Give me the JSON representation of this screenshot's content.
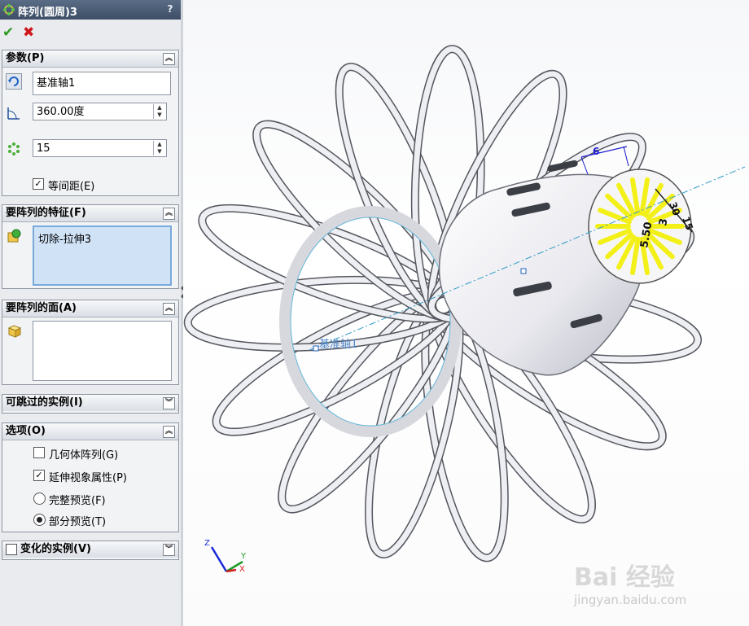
{
  "title": "阵列(圆周)3",
  "help_label": "?",
  "ok_label": "✔",
  "cancel_label": "✖",
  "params": {
    "header": "参数(P)",
    "axis_value": "基准轴1",
    "angle_value": "360.00度",
    "count_value": "15",
    "equal_spacing_label": "等间距(E)",
    "equal_spacing_checked": true
  },
  "features": {
    "header": "要阵列的特征(F)",
    "items": [
      "切除-拉伸3"
    ]
  },
  "faces": {
    "header": "要阵列的面(A)"
  },
  "skip": {
    "header": "可跳过的实例(I)"
  },
  "options": {
    "header": "选项(O)",
    "geometry_pattern_label": "几何体阵列(G)",
    "geometry_pattern_checked": false,
    "propagate_visual_label": "延伸视象属性(P)",
    "propagate_visual_checked": true,
    "full_preview_label": "完整预览(F)",
    "partial_preview_label": "部分预览(T)",
    "preview_mode": "partial"
  },
  "vary": {
    "header": "变化的实例(V)",
    "checked": false
  },
  "viewport": {
    "axis_label": "基准轴1",
    "dim_6": "6",
    "dim_30": "30",
    "dim_3": "3",
    "dim_5_50": "5.50",
    "dim_15": "15",
    "triad_z": "Z",
    "triad_y": "Y",
    "triad_x": "X",
    "watermark_brand": "Bai 经验",
    "watermark_url": "jingyan.baidu.com"
  },
  "colors": {
    "title_bg": "#3d4e66",
    "accent_yellow": "#f3f019",
    "dim_blue": "#1a1ad0",
    "ok_green": "#2e9a24",
    "cancel_red": "#d0161b"
  }
}
